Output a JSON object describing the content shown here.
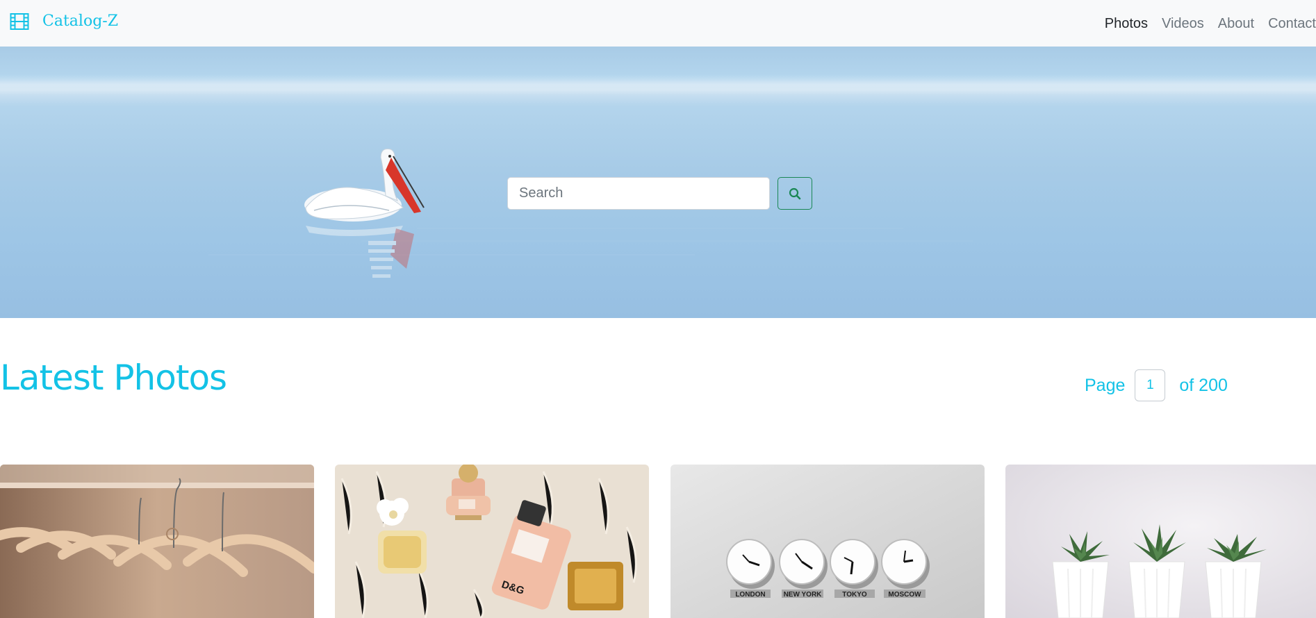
{
  "app": {
    "brand": "Catalog-Z",
    "accent_color": "#13c2e6"
  },
  "nav": {
    "items": [
      {
        "label": "Photos",
        "active": true
      },
      {
        "label": "Videos",
        "active": false
      },
      {
        "label": "About",
        "active": false
      },
      {
        "label": "Contact",
        "active": false
      }
    ]
  },
  "hero": {
    "search_placeholder": "Search",
    "search_icon": "search-icon"
  },
  "section": {
    "title": "Latest Photos"
  },
  "pagination": {
    "prefix": "Page",
    "current": "1",
    "suffix": "of 200"
  },
  "gallery": {
    "clock_labels": [
      "LONDON",
      "NEW YORK",
      "TOKYO",
      "MOSCOW"
    ]
  }
}
